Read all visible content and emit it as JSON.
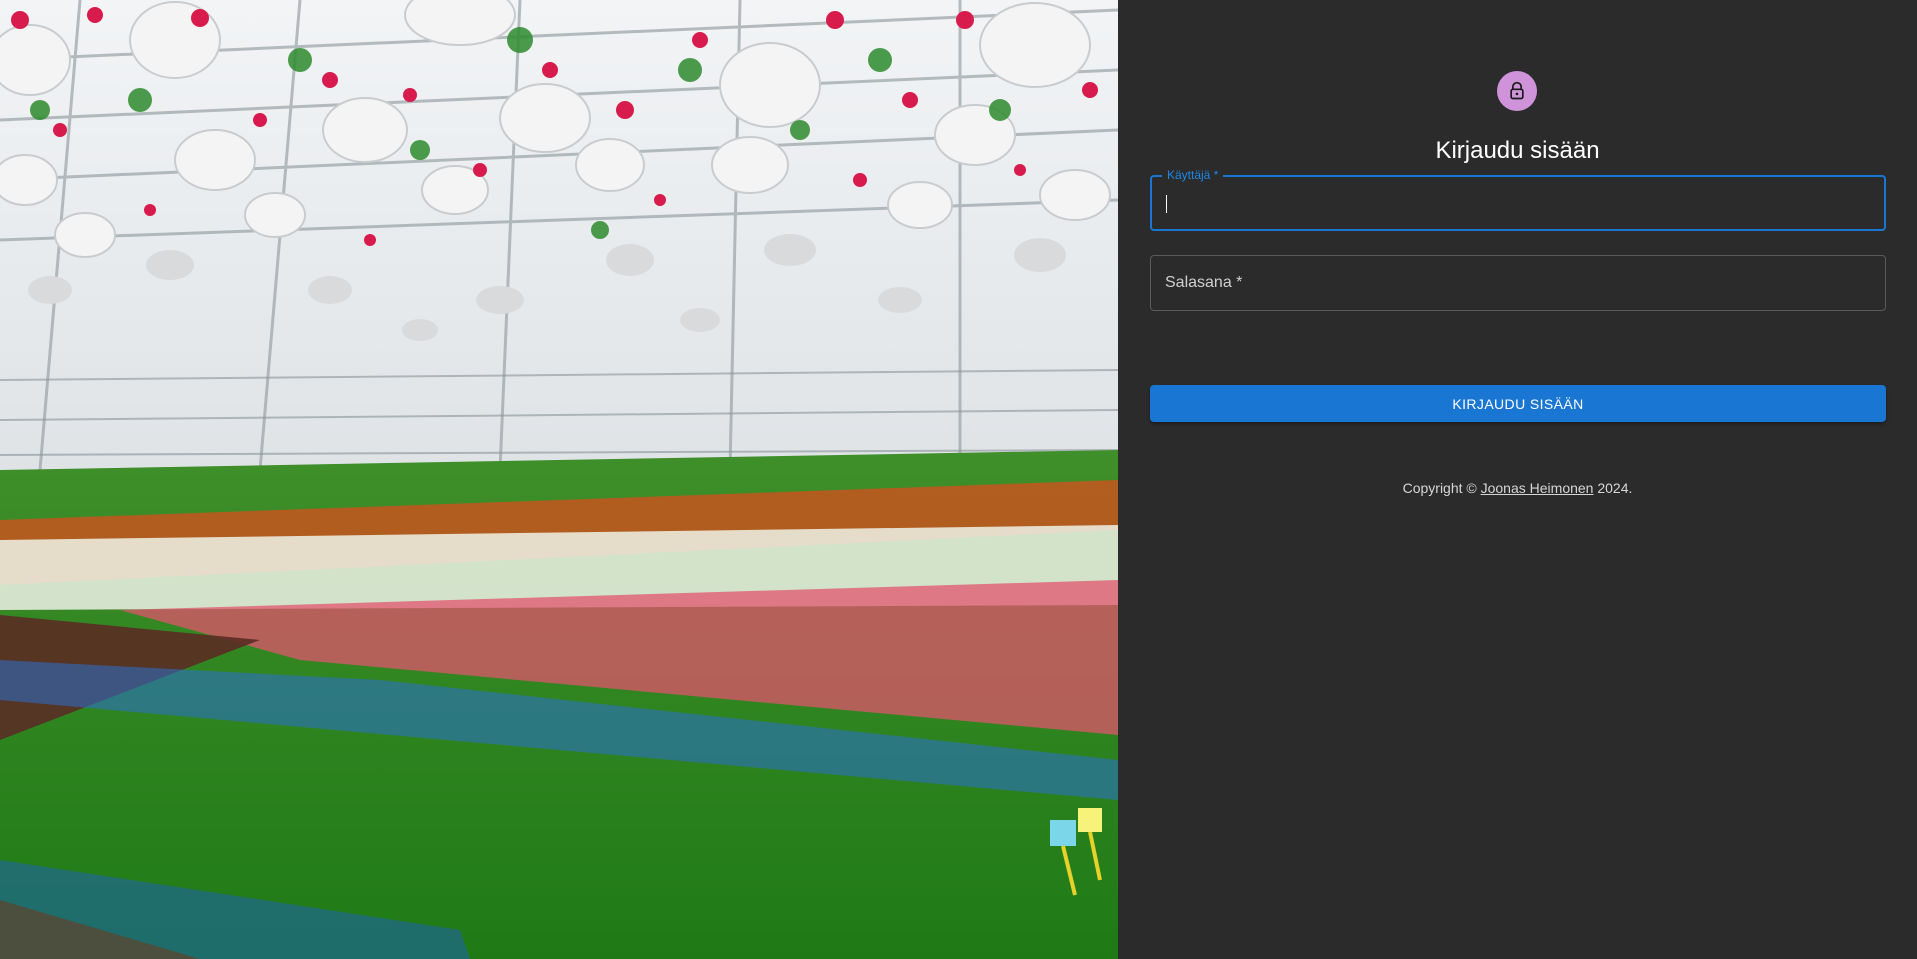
{
  "login": {
    "title": "Kirjaudu sisään",
    "username_label": "Käyttäjä *",
    "username_value": "",
    "password_label": "Salasana *",
    "password_value": "",
    "submit_label": "KIRJAUDU SISÄÄN",
    "copyright_prefix": "Copyright ©",
    "copyright_link": "Joonas Heimonen",
    "copyright_suffix": "2024."
  },
  "icons": {
    "avatar": "lock-icon"
  },
  "colors": {
    "background": "#2b2b2b",
    "accent": "#1976d2",
    "avatar": "#ce93d8"
  }
}
